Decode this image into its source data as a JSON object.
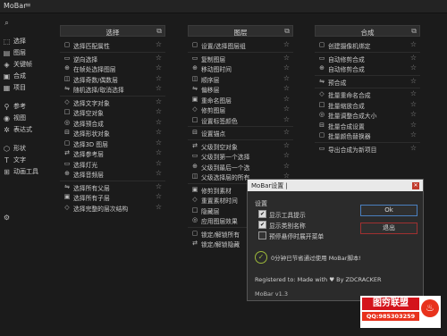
{
  "app": {
    "title": "MoBar",
    "menu_icon": "hamburger-icon"
  },
  "sidebar": {
    "search_icon": "search-icon",
    "items": [
      {
        "label": "选择",
        "icon": "select-icon"
      },
      {
        "label": "图层",
        "icon": "layers-icon"
      },
      {
        "label": "关键帧",
        "icon": "keyframe-icon"
      },
      {
        "label": "合成",
        "icon": "composition-icon"
      },
      {
        "label": "项目",
        "icon": "project-icon"
      },
      {
        "label": "参考",
        "icon": "reference-icon"
      },
      {
        "label": "视图",
        "icon": "eye-icon"
      },
      {
        "label": "表达式",
        "icon": "expression-icon"
      },
      {
        "label": "形状",
        "icon": "shape-icon"
      },
      {
        "label": "文字",
        "icon": "text-icon"
      },
      {
        "label": "动画工具",
        "icon": "animation-tools-icon"
      }
    ],
    "settings_icon": "gear-icon"
  },
  "panels": [
    {
      "title": "选择",
      "rows": [
        "选择匹配属性",
        "sep",
        "逆向选择",
        "在帧处选择图层",
        "选择奇数/偶数层",
        "随机选择/取消选择",
        "sep",
        "选择文字对象",
        "选择空对象",
        "选择预合成",
        "选择形状对象",
        "选择3D 图层",
        "选择参考层",
        "选择灯光",
        "选择音频层",
        "sep",
        "选择所有父层",
        "选择所有子层",
        "选择完整的层次结构"
      ]
    },
    {
      "title": "图层",
      "rows": [
        "设置/选择图层组",
        "sep",
        "复制图层",
        "移动图时间",
        "顺序层",
        "偏移层",
        "重命名图层",
        "修剪图层",
        "设置标签颜色",
        "sep",
        "设置锚点",
        "sep",
        "父级到空对象",
        "父级到第一个选择",
        "父级到最后一个选",
        "父级选择层的所有",
        "sep",
        "修剪到素材",
        "重置素材时间",
        "隐藏层",
        "应用图层效果",
        "sep",
        "锁定/解锁所有",
        "锁定/解锁隐藏"
      ]
    },
    {
      "title": "合成",
      "rows": [
        "创建摄像机绑定",
        "sep",
        "自动修剪合成",
        "自动修剪合成",
        "sep",
        "预合成",
        "sep",
        "批量重命名合成",
        "批量缩放合成",
        "批量调整合成大小",
        "批量合成设置",
        "批量颜色替换器",
        "sep",
        "导出合成为新项目"
      ]
    }
  ],
  "dialog": {
    "title": "MoBar设置 |",
    "section": "设置",
    "options": [
      {
        "label": "显示工具提示",
        "checked": true
      },
      {
        "label": "显示类别名称",
        "checked": true
      },
      {
        "label": "预停悬停时展开菜单",
        "checked": false
      }
    ],
    "ok_label": "Ok",
    "exit_label": "退出",
    "saved_text": "0分钟已节省通过使用 MoBar脚本!",
    "registered_text": "Registered to: Made with ♥ By ZDCRACKER",
    "version": "MoBar v1.3"
  },
  "watermark": {
    "line1": "图穷联盟",
    "line2": "QQ:985303259"
  },
  "colors": {
    "ok_border": "#4a7fbf",
    "exit_border": "#a03030",
    "saved_green": "#9cb83a"
  }
}
